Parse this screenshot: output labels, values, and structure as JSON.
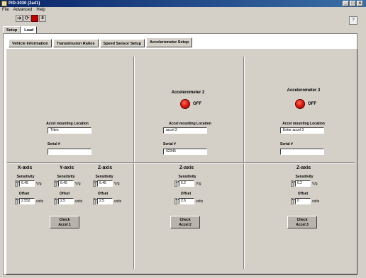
{
  "window": {
    "title": "PID-3030 (2a41)",
    "minimize": "_",
    "maximize": "□",
    "close": "×"
  },
  "menu": [
    "File",
    "Advanced",
    "Help"
  ],
  "toolbar": {
    "run_icon": "run-arrow-icon",
    "run_continuous_icon": "run-continuous-icon",
    "abort_icon": "abort-stop-icon",
    "pause_label": "II",
    "context_help_icon": "context-help-icon"
  },
  "top_tabs": [
    "Setup",
    "Load"
  ],
  "inner_tabs": [
    "Vehicle Information",
    "Transmission Ratios",
    "Speed Sensor Setup",
    "Accelerometer Setup"
  ],
  "accelerometer_1": {
    "mounting_label": "Accel mounting Location",
    "mounting_value": "Trbm",
    "serial_label": "Serial #",
    "serial_value": "",
    "axes": [
      {
        "title": "X-axis",
        "sensitivity_label": "Sensitivity",
        "sensitivity": "6.45",
        "sens_unit": "V/g",
        "offset_label": "Offset",
        "offset": "2.552",
        "offset_unit": "volts"
      },
      {
        "title": "Y-axis",
        "sensitivity_label": "Sensitivity",
        "sensitivity": "6.45",
        "sens_unit": "V/g",
        "offset_label": "Offset",
        "offset": "2.5",
        "offset_unit": "volts"
      },
      {
        "title": "Z-axis",
        "sensitivity_label": "Sensitivity",
        "sensitivity": "6.45",
        "sens_unit": "V/g",
        "offset_label": "Offset",
        "offset": "2.5",
        "offset_unit": "volts"
      }
    ],
    "check_button": [
      "Check",
      "Accel 1"
    ]
  },
  "accelerometer_2": {
    "title": "Accelerometer 2",
    "status": "OFF",
    "mounting_label": "Accel mounting Location",
    "mounting_value": "accel 2",
    "serial_label": "Serial #",
    "serial_value": "92345",
    "axis_title": "Z-axis",
    "sensitivity_label": "Sensitivity",
    "sensitivity": "6.2",
    "sens_unit": "V/g",
    "offset_label": "Offset",
    "offset": "2.6",
    "offset_unit": "volts",
    "check_button": [
      "Check",
      "Accel 2"
    ]
  },
  "accelerometer_3": {
    "title": "Accelerometer 3",
    "status": "OFF",
    "mounting_label": "Accel mounting Location",
    "mounting_value": "Enter accel 3",
    "serial_label": "Serial #",
    "serial_value": "",
    "axis_title": "Z-axis",
    "sensitivity_label": "Sensitivity",
    "sensitivity": "6.2",
    "sens_unit": "V/g",
    "offset_label": "Offset",
    "offset": "0",
    "offset_unit": "volts",
    "check_button": [
      "Check",
      "Accel 3"
    ]
  },
  "colors": {
    "led_off": "#e02010",
    "title_bar": "#0a246a",
    "panel": "#d4d0c8"
  }
}
